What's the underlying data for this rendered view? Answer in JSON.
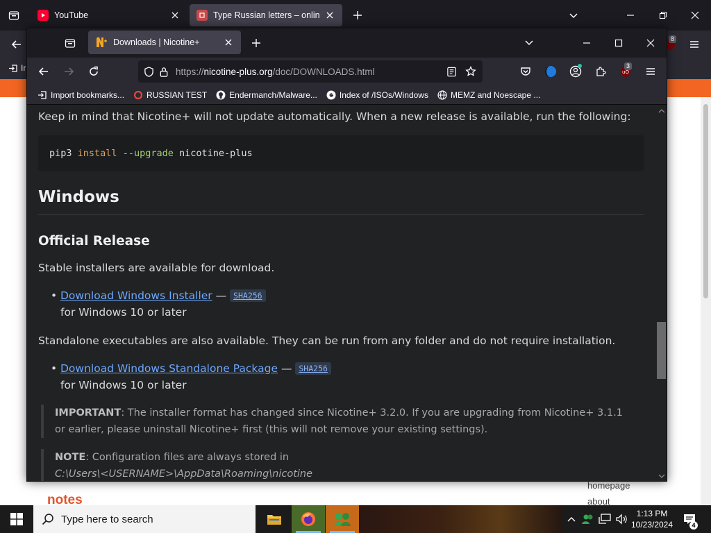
{
  "outer_browser": {
    "tabs": [
      {
        "label": "YouTube"
      },
      {
        "label": "Type Russian letters – online Ru"
      }
    ],
    "bookmark_partial": "Ir",
    "extension_badge": "8",
    "content": {
      "notes_heading": "notes",
      "links": [
        "homepage",
        "about"
      ]
    }
  },
  "firefox": {
    "tab": {
      "label": "Downloads | Nicotine+"
    },
    "url": {
      "prefix": "https://",
      "domain": "nicotine-plus.org",
      "path": "/doc/DOWNLOADS.html"
    },
    "extension_badge": "3",
    "bookmarks": [
      {
        "label": "Import bookmarks...",
        "icon": "import-icon"
      },
      {
        "label": "RUSSIAN TEST",
        "icon": "ring-icon"
      },
      {
        "label": "Endermanch/Malware...",
        "icon": "github-icon"
      },
      {
        "label": "Index of /ISOs/Windows",
        "icon": "google-icon"
      },
      {
        "label": "MEMZ and Noescape ...",
        "icon": "globe-icon"
      }
    ]
  },
  "page": {
    "intro": "Keep in mind that Nicotine+ will not update automatically. When a new release is available, run the following:",
    "code": {
      "cmd": "pip3",
      "kw": "install",
      "flag": "--upgrade",
      "arg": "nicotine-plus"
    },
    "h2": "Windows",
    "h3": "Official Release",
    "stable_text": "Stable installers are available for download.",
    "installer": {
      "link": "Download Windows Installer",
      "dash": "—",
      "sha": "SHA256",
      "sub": "for Windows 10 or later"
    },
    "standalone_text": "Standalone executables are also available. They can be run from any folder and do not require installation.",
    "standalone": {
      "link": "Download Windows Standalone Package",
      "dash": "—",
      "sha": "SHA256",
      "sub": "for Windows 10 or later"
    },
    "important": {
      "label": "IMPORTANT",
      "text": ": The installer format has changed since Nicotine+ 3.2.0. If you are upgrading from Nicotine+ 3.1.1 or earlier, please uninstall Nicotine+ first (this will not remove your existing settings)."
    },
    "note": {
      "label": "NOTE",
      "text": ": Configuration files are always stored in",
      "path": "C:\\Users\\<USERNAME>\\AppData\\Roaming\\nicotine"
    }
  },
  "taskbar": {
    "search_placeholder": "Type here to search",
    "time": "1:13 PM",
    "date": "10/23/2024",
    "notification_count": "4"
  },
  "colors": {
    "firefox_frame": "#1c1b22",
    "toolbar": "#2b2a33",
    "page_bg": "#202224",
    "link": "#6ea8fe",
    "orange_bar": "#f26522"
  }
}
